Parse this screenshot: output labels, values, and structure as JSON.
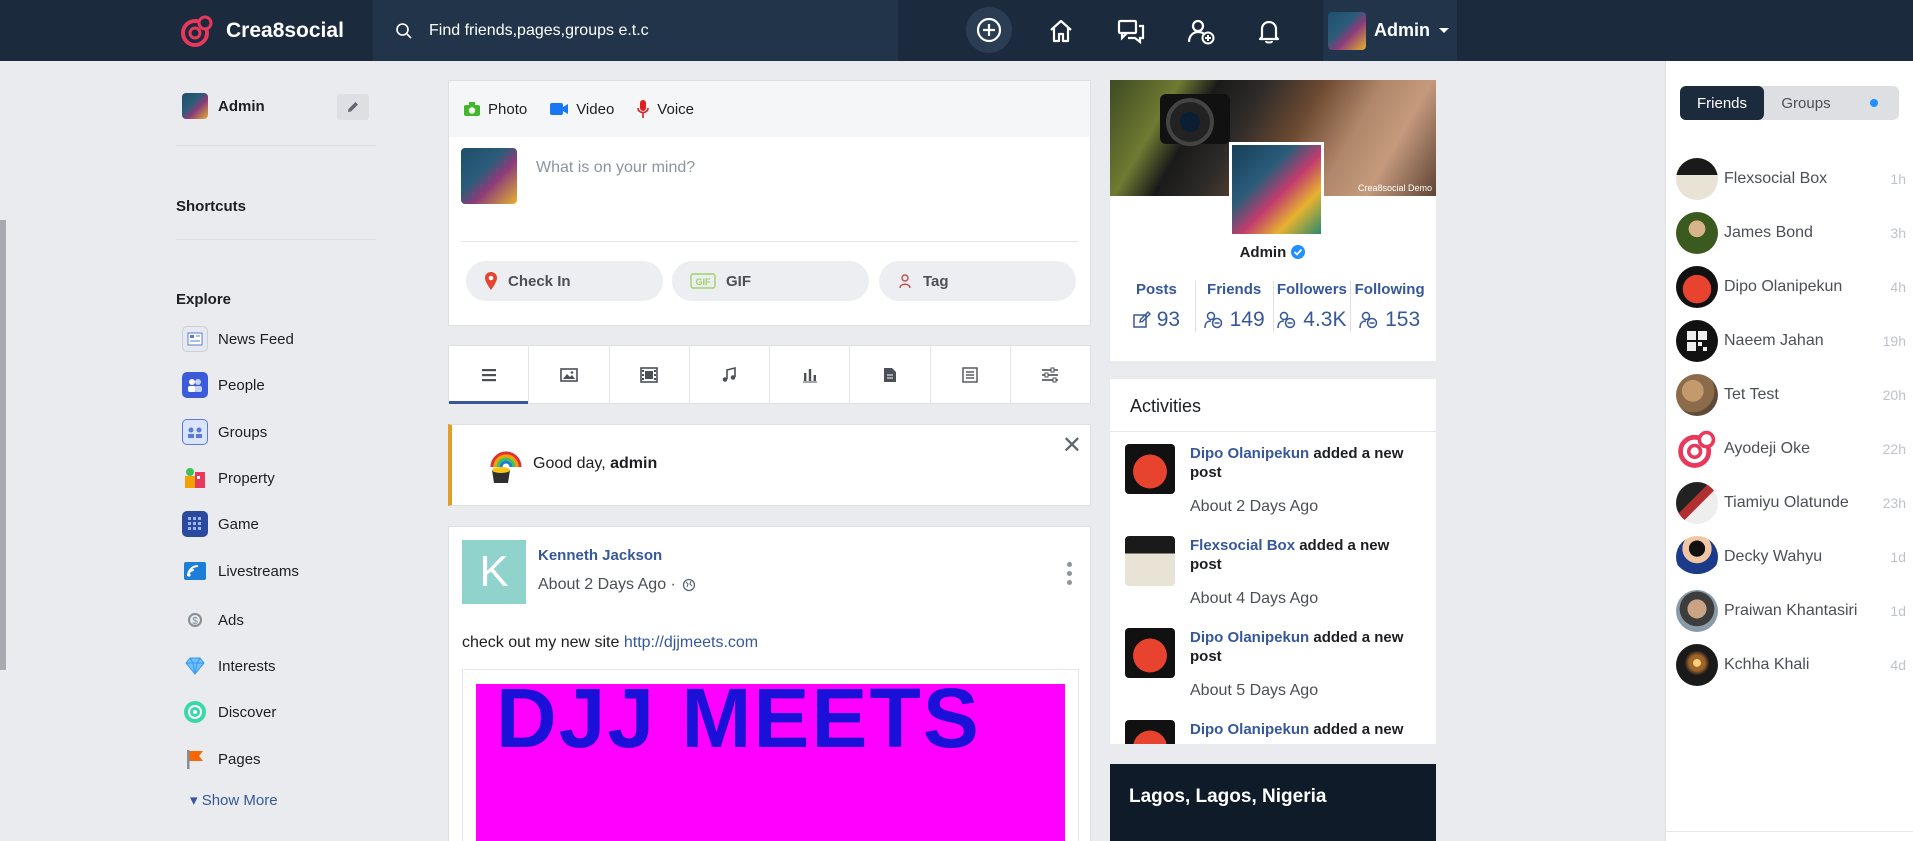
{
  "header": {
    "brand": "Crea8social",
    "search_placeholder": "Find friends,pages,groups e.t.c",
    "user_name": "Admin",
    "icons": [
      "plus-circle-icon",
      "home-icon",
      "messages-icon",
      "friend-requests-icon",
      "bell-icon"
    ]
  },
  "sidebar": {
    "user_name": "Admin",
    "shortcuts_title": "Shortcuts",
    "explore_title": "Explore",
    "items": [
      {
        "label": "News Feed",
        "icon": "news-feed-icon",
        "color": "#e6e9f0"
      },
      {
        "label": "People",
        "icon": "people-icon",
        "color": "#3b5bdb"
      },
      {
        "label": "Groups",
        "icon": "groups-icon",
        "color": "#5b7bd5"
      },
      {
        "label": "Property",
        "icon": "property-icon",
        "color": "#f59f00"
      },
      {
        "label": "Game",
        "icon": "game-icon",
        "color": "#2b4a9e"
      },
      {
        "label": "Livestreams",
        "icon": "livestream-icon",
        "color": "#1c7ed6"
      },
      {
        "label": "Ads",
        "icon": "ads-icon",
        "color": "#868e96"
      },
      {
        "label": "Interests",
        "icon": "interests-icon",
        "color": "#74c0fc"
      },
      {
        "label": "Discover",
        "icon": "discover-icon",
        "color": "#38d9a9"
      },
      {
        "label": "Pages",
        "icon": "pages-icon",
        "color": "#f76707"
      }
    ],
    "show_more": "Show More"
  },
  "composer": {
    "tabs": [
      {
        "label": "Photo",
        "icon": "camera-icon",
        "color": "#42b72a"
      },
      {
        "label": "Video",
        "icon": "video-icon",
        "color": "#1877f2"
      },
      {
        "label": "Voice",
        "icon": "mic-icon",
        "color": "#e02020"
      }
    ],
    "placeholder": "What is on your mind?",
    "actions": [
      {
        "label": "Check In",
        "icon": "location-pin-icon"
      },
      {
        "label": "GIF",
        "icon": "gif-icon"
      },
      {
        "label": "Tag",
        "icon": "tag-icon"
      }
    ]
  },
  "feed_filters": [
    "all-icon",
    "image-icon",
    "film-icon",
    "music-icon",
    "poll-icon",
    "document-icon",
    "list-icon",
    "sliders-icon"
  ],
  "greeting": {
    "prefix": "Good day, ",
    "name": "admin"
  },
  "post": {
    "avatar_letter": "K",
    "author": "Kenneth Jackson",
    "time": "About 2 Days Ago ·",
    "text": "check out my new site ",
    "link": "http://djjmeets.com",
    "preview_title": "DJJ MEETS"
  },
  "profile": {
    "cover_caption": "Crea8social Demo",
    "name": "Admin",
    "stats": [
      {
        "label": "Posts",
        "value": "93",
        "icon": "edit-icon"
      },
      {
        "label": "Friends",
        "value": "149",
        "icon": "friends-icon"
      },
      {
        "label": "Followers",
        "value": "4.3K",
        "icon": "friends-icon"
      },
      {
        "label": "Following",
        "value": "153",
        "icon": "friends-icon"
      }
    ]
  },
  "activities": {
    "title": "Activities",
    "items": [
      {
        "who": "Dipo Olanipekun",
        "action": " added a new post",
        "time": "About 2 Days Ago"
      },
      {
        "who": "Flexsocial Box",
        "action": " added a new post",
        "time": "About 4 Days Ago"
      },
      {
        "who": "Dipo Olanipekun",
        "action": " added a new post",
        "time": "About 5 Days Ago"
      },
      {
        "who": "Dipo Olanipekun",
        "action": " added a new",
        "time": ""
      }
    ]
  },
  "location": "Lagos, Lagos, Nigeria",
  "chat": {
    "tabs": [
      "Friends",
      "Groups"
    ],
    "friends": [
      {
        "name": "Flexsocial Box",
        "time": "1h"
      },
      {
        "name": "James Bond",
        "time": "3h"
      },
      {
        "name": "Dipo Olanipekun",
        "time": "4h"
      },
      {
        "name": "Naeem Jahan",
        "time": "19h"
      },
      {
        "name": "Tet Test",
        "time": "20h"
      },
      {
        "name": "Ayodeji Oke",
        "time": "22h"
      },
      {
        "name": "Tiamiyu Olatunde",
        "time": "23h"
      },
      {
        "name": "Decky Wahyu",
        "time": "1d"
      },
      {
        "name": "Praiwan Khantasiri",
        "time": "1d"
      },
      {
        "name": "Kchha Khali",
        "time": "4d"
      }
    ]
  }
}
